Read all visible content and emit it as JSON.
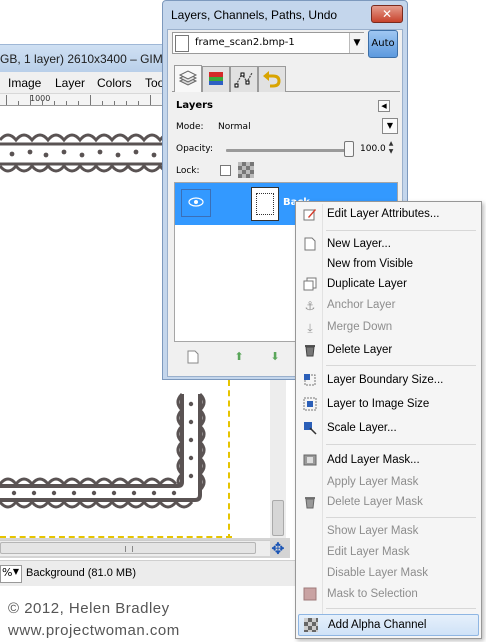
{
  "main_window": {
    "title": "GB, 1 layer) 2610x3400 – GIMP",
    "menus": [
      "Image",
      "Layer",
      "Colors",
      "Too"
    ],
    "ruler_label": "1000",
    "zoom_value": "%",
    "status": "Background (81.0 MB)"
  },
  "watermark": {
    "copyright": "© 2012, Helen Bradley",
    "website": "www.projectwoman.com"
  },
  "dock": {
    "title": "Layers, Channels, Paths, Undo",
    "close_glyph": "✕",
    "image_name": "frame_scan2.bmp-1",
    "auto_label": "Auto",
    "tab_icons": [
      "layers-tab-icon",
      "channels-tab-icon",
      "paths-tab-icon",
      "undo-tab-icon"
    ]
  },
  "layers_panel": {
    "header": "Layers",
    "mode_label": "Mode:",
    "mode_value": "Normal",
    "opacity_label": "Opacity:",
    "opacity_value": "100.0",
    "opacity": 1.0,
    "lock_label": "Lock:",
    "layer": {
      "name": "Back",
      "visible": true
    }
  },
  "context_menu": {
    "items": [
      {
        "label": "Edit Layer Attributes...",
        "icon": "edit-attributes-icon",
        "enabled": true
      },
      {
        "sep": true
      },
      {
        "label": "New Layer...",
        "icon": "new-layer-icon",
        "enabled": true
      },
      {
        "label": "New from Visible",
        "icon": "",
        "enabled": true
      },
      {
        "label": "Duplicate Layer",
        "icon": "duplicate-layer-icon",
        "enabled": true
      },
      {
        "label": "Anchor Layer",
        "icon": "anchor-icon",
        "enabled": false
      },
      {
        "label": "Merge Down",
        "icon": "merge-down-icon",
        "enabled": false
      },
      {
        "label": "Delete Layer",
        "icon": "trash-icon",
        "enabled": true
      },
      {
        "sep": true
      },
      {
        "label": "Layer Boundary Size...",
        "icon": "boundary-size-icon",
        "enabled": true
      },
      {
        "label": "Layer to Image Size",
        "icon": "layer-to-image-icon",
        "enabled": true
      },
      {
        "label": "Scale Layer...",
        "icon": "scale-layer-icon",
        "enabled": true
      },
      {
        "sep": true
      },
      {
        "label": "Add Layer Mask...",
        "icon": "add-mask-icon",
        "enabled": true
      },
      {
        "label": "Apply Layer Mask",
        "icon": "",
        "enabled": false
      },
      {
        "label": "Delete Layer Mask",
        "icon": "delete-mask-icon",
        "enabled": false
      },
      {
        "sep": true
      },
      {
        "label": "Show Layer Mask",
        "icon": "",
        "enabled": false
      },
      {
        "label": "Edit Layer Mask",
        "icon": "",
        "enabled": false
      },
      {
        "label": "Disable Layer Mask",
        "icon": "",
        "enabled": false
      },
      {
        "label": "Mask to Selection",
        "icon": "mask-selection-icon",
        "enabled": false
      },
      {
        "sep": true
      },
      {
        "label": "Add Alpha Channel",
        "icon": "alpha-channel-icon",
        "enabled": true,
        "highlighted": true
      }
    ]
  },
  "colors": {
    "dock_border": "#7d99bd",
    "selected_row": "#3399ff",
    "guide": "#e6c400",
    "frame_ink": "#5a5353"
  }
}
